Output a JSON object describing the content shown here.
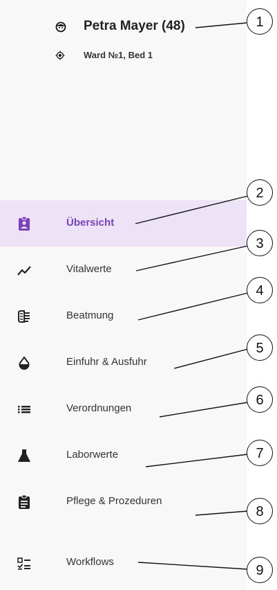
{
  "patient": {
    "name": "Petra Mayer (48)",
    "location": "Ward №1, Bed 1"
  },
  "nav": {
    "items": [
      {
        "label": "Übersicht",
        "icon": "clipboard-account-icon",
        "active": true
      },
      {
        "label": "Vitalwerte",
        "icon": "trending-up-icon",
        "active": false
      },
      {
        "label": "Beatmung",
        "icon": "lungs-icon",
        "active": false
      },
      {
        "label": "Einfuhr & Ausfuhr",
        "icon": "water-drop-icon",
        "active": false
      },
      {
        "label": "Verordnungen",
        "icon": "list-icon",
        "active": false
      },
      {
        "label": "Laborwerte",
        "icon": "flask-icon",
        "active": false
      },
      {
        "label": "Pflege & Prozeduren",
        "icon": "clipboard-text-icon",
        "active": false
      },
      {
        "label": "Workflows",
        "icon": "checklist-icon",
        "active": false
      }
    ]
  },
  "callouts": [
    "1",
    "2",
    "3",
    "4",
    "5",
    "6",
    "7",
    "8",
    "9"
  ],
  "colors": {
    "accent": "#7b3fbf",
    "active_bg": "#ece4f6"
  }
}
